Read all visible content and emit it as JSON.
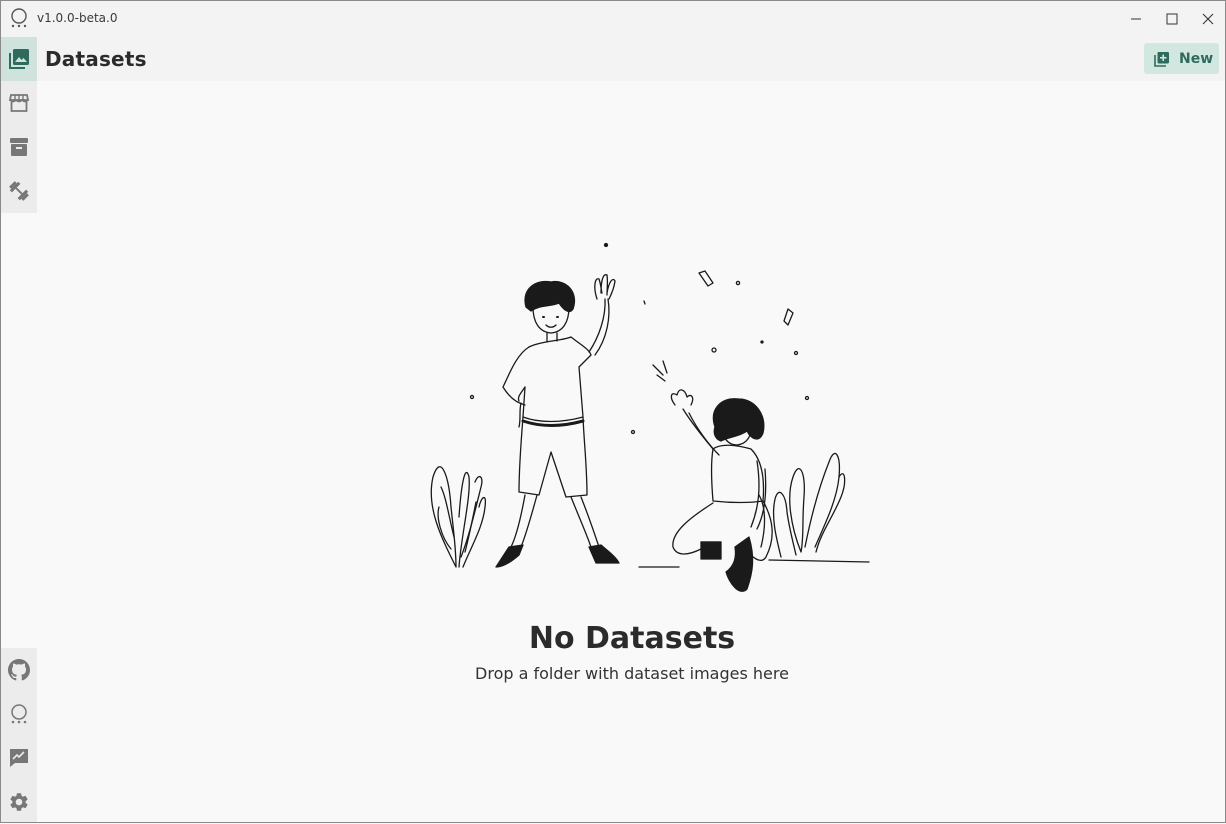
{
  "app": {
    "version": "v1.0.0-beta.0"
  },
  "header": {
    "title": "Datasets",
    "new_label": "New"
  },
  "sidebar": {
    "top_items": [
      {
        "name": "datasets",
        "icon": "image-stack-icon",
        "active": true
      },
      {
        "name": "marketplace",
        "icon": "storefront-icon",
        "active": false
      },
      {
        "name": "archive",
        "icon": "archive-box-icon",
        "active": false
      },
      {
        "name": "training",
        "icon": "dumbbell-icon",
        "active": false
      }
    ],
    "bottom_items": [
      {
        "name": "github",
        "icon": "github-icon"
      },
      {
        "name": "app-logo",
        "icon": "app-logo-icon"
      },
      {
        "name": "feedback",
        "icon": "feedback-icon"
      },
      {
        "name": "settings",
        "icon": "gear-icon"
      }
    ]
  },
  "empty_state": {
    "title": "No Datasets",
    "subtitle": "Drop a folder with dataset images here"
  },
  "colors": {
    "accent": "#2f6b5c",
    "accent_bg": "#d3e7e1",
    "sidebar_active": "#cfe3dc",
    "background": "#f9f9f9"
  }
}
